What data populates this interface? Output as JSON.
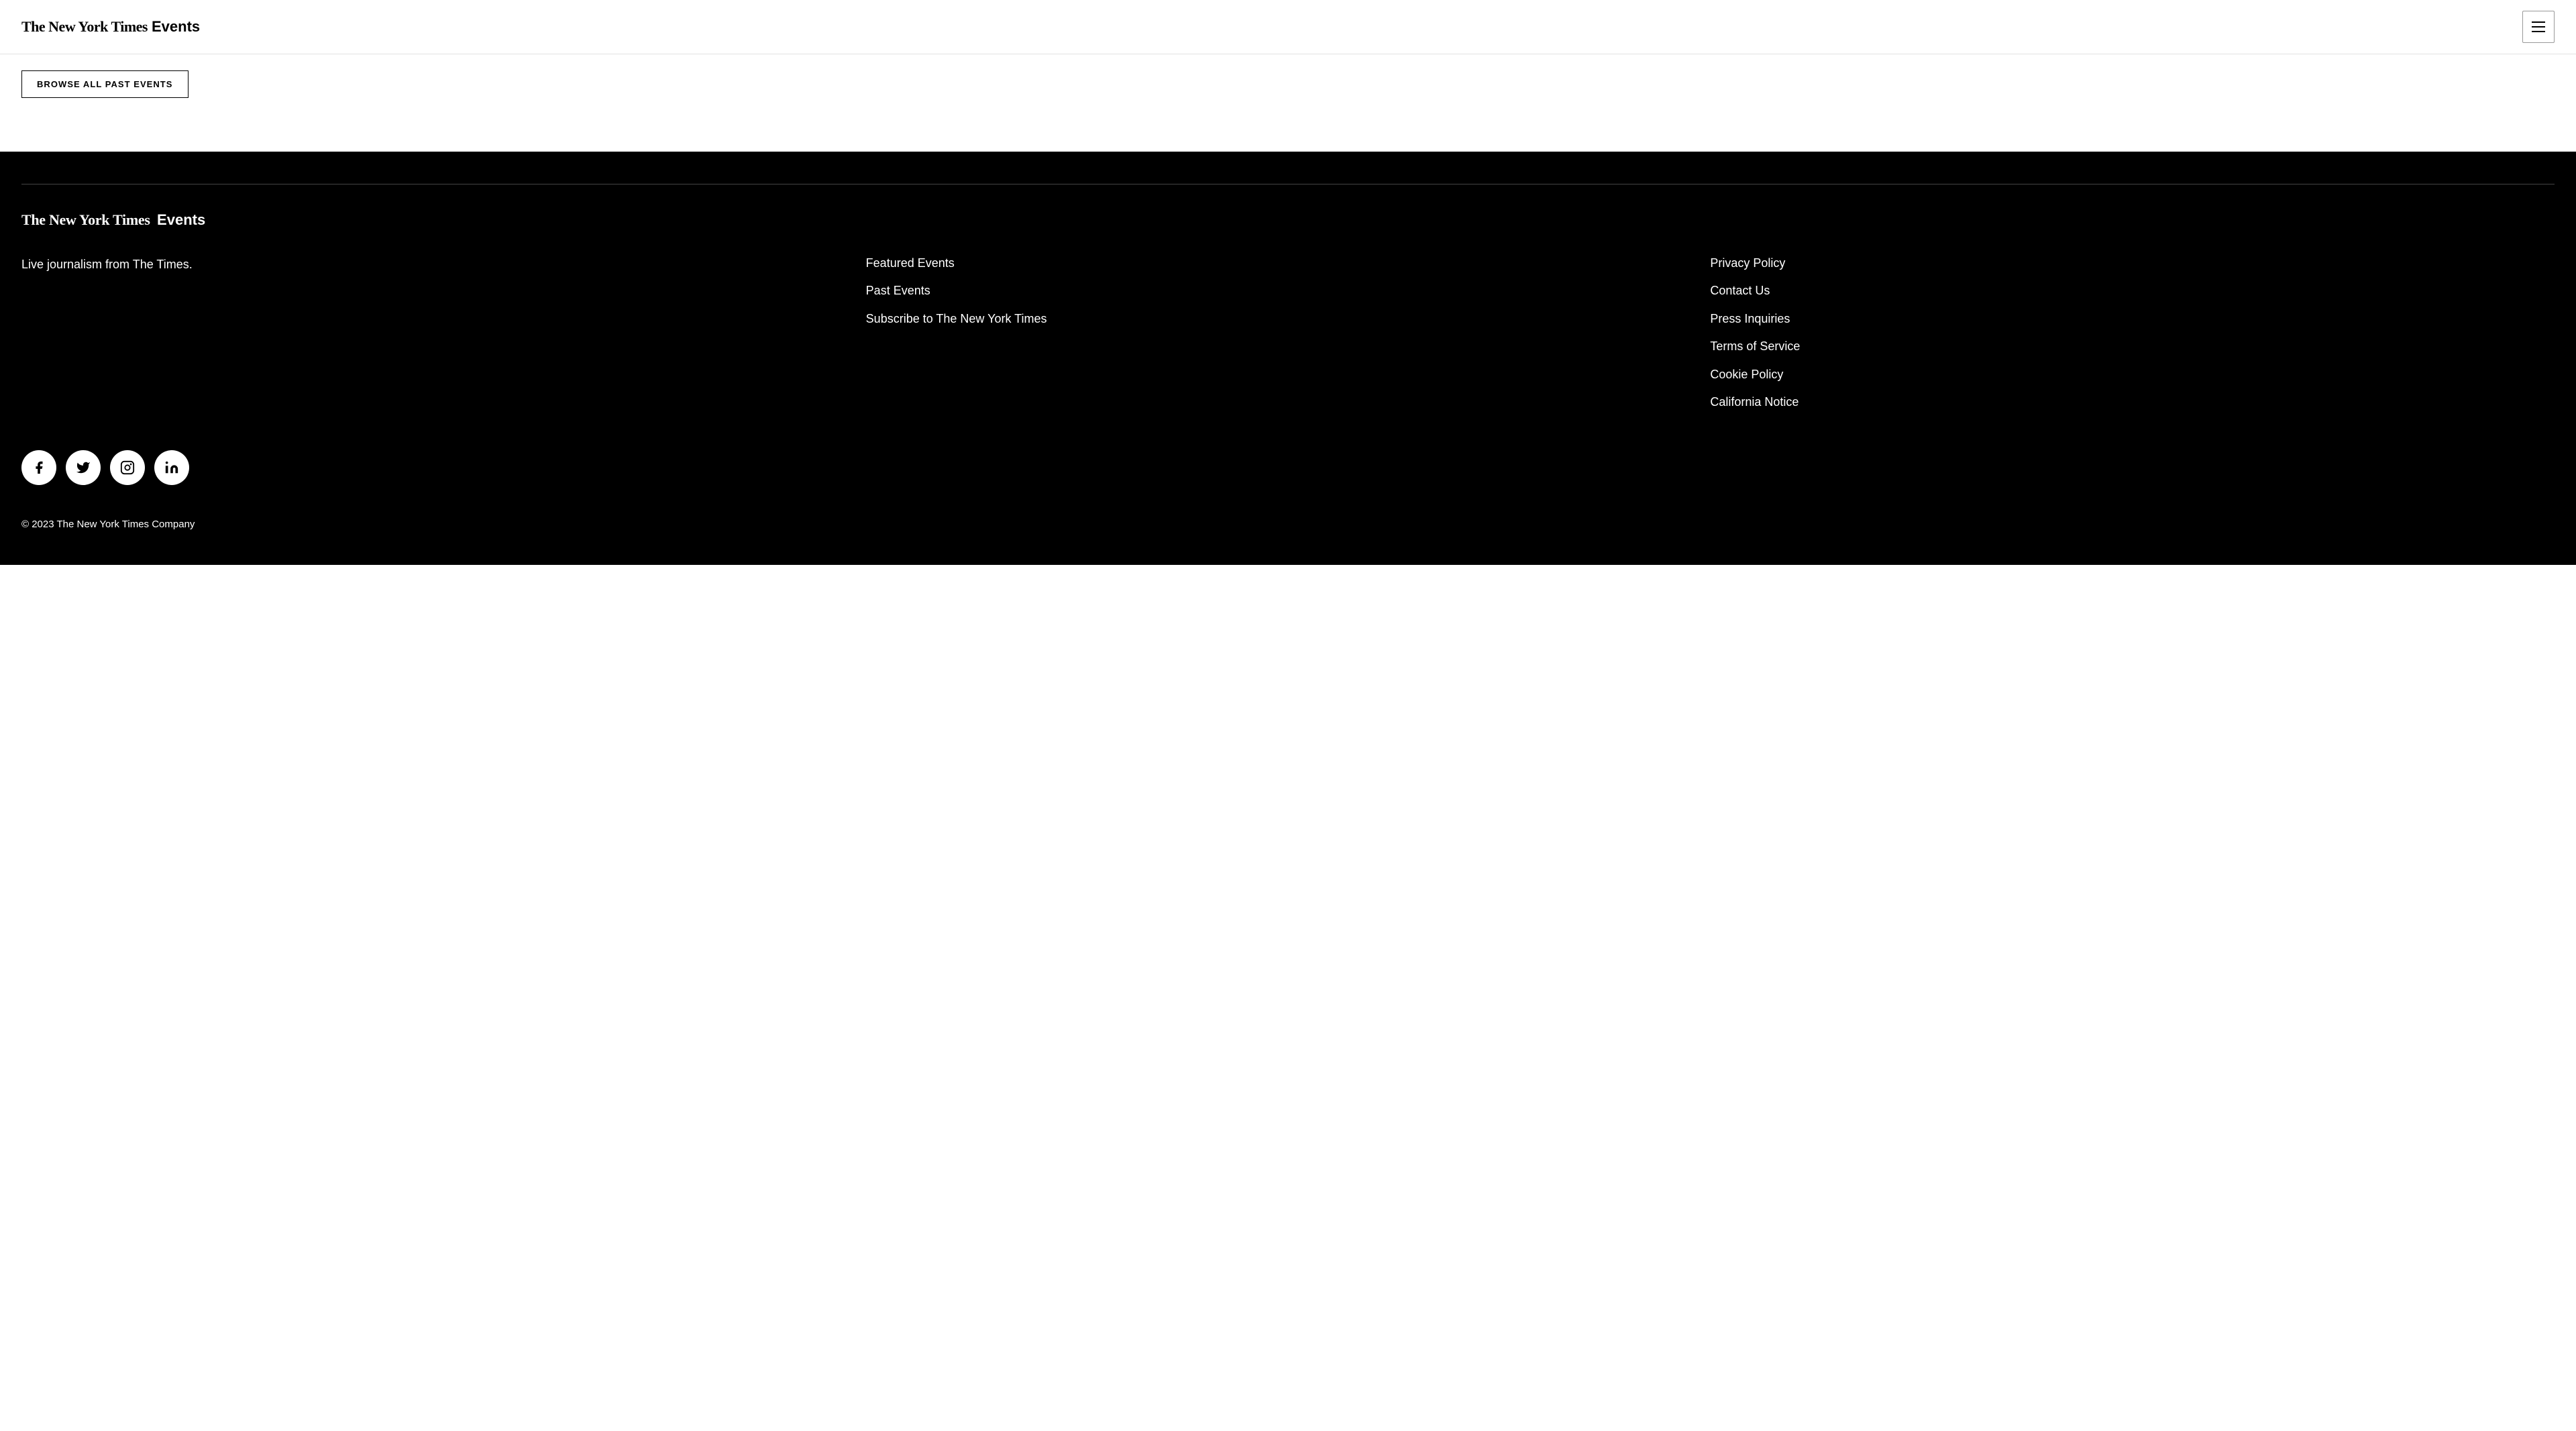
{
  "header": {
    "logo_nyt": "The New York Times",
    "logo_events": "Events",
    "menu_label": "Menu"
  },
  "main": {
    "browse_button_label": "BROWSE ALL PAST EVENTS"
  },
  "footer": {
    "logo_nyt": "The New York Times",
    "logo_events": "Events",
    "tagline": "Live journalism from The Times.",
    "nav_links": [
      {
        "label": "Featured Events",
        "href": "#"
      },
      {
        "label": "Past Events",
        "href": "#"
      },
      {
        "label": "Subscribe to The New York Times",
        "href": "#"
      }
    ],
    "legal_links": [
      {
        "label": "Privacy Policy",
        "href": "#"
      },
      {
        "label": "Contact Us",
        "href": "#"
      },
      {
        "label": "Press Inquiries",
        "href": "#"
      },
      {
        "label": "Terms of Service",
        "href": "#"
      },
      {
        "label": "Cookie Policy",
        "href": "#"
      },
      {
        "label": "California Notice",
        "href": "#"
      }
    ],
    "social": [
      {
        "name": "facebook",
        "label": "Facebook"
      },
      {
        "name": "twitter",
        "label": "Twitter"
      },
      {
        "name": "instagram",
        "label": "Instagram"
      },
      {
        "name": "linkedin",
        "label": "LinkedIn"
      }
    ],
    "copyright": "© 2023 The New York Times Company"
  }
}
